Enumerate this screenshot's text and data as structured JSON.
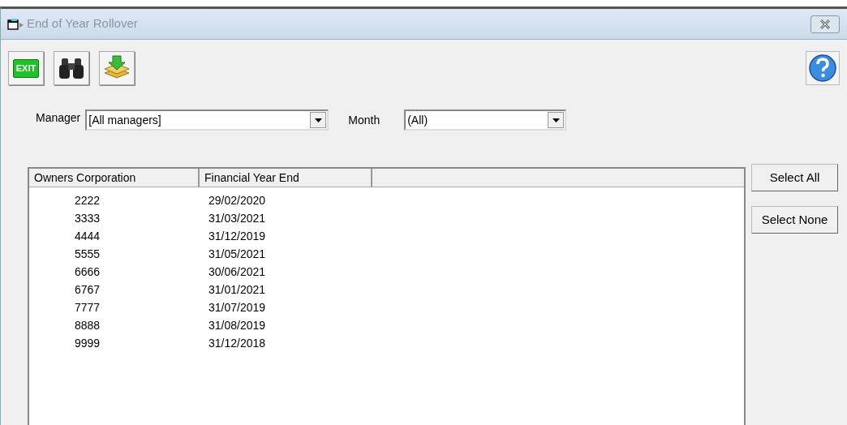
{
  "window": {
    "title": "End of Year Rollover"
  },
  "toolbar": [
    {
      "kind": "exit",
      "label": "EXIT"
    },
    {
      "kind": "find"
    },
    {
      "kind": "rollover"
    }
  ],
  "filters": [
    {
      "label": "Manager",
      "value": "[All managers]"
    },
    {
      "label": "Month",
      "value": "(All)"
    }
  ],
  "table": {
    "columns": [
      "Owners Corporation",
      "Financial Year End"
    ],
    "rows": [
      [
        "2222",
        "29/02/2020"
      ],
      [
        "3333",
        "31/03/2021"
      ],
      [
        "4444",
        "31/12/2019"
      ],
      [
        "5555",
        "31/05/2021"
      ],
      [
        "6666",
        "30/06/2021"
      ],
      [
        "6767",
        "31/01/2021"
      ],
      [
        "7777",
        "31/07/2019"
      ],
      [
        "8888",
        "31/08/2019"
      ],
      [
        "9999",
        "31/12/2018"
      ]
    ]
  },
  "buttons": [
    "Select All",
    "Select None"
  ]
}
